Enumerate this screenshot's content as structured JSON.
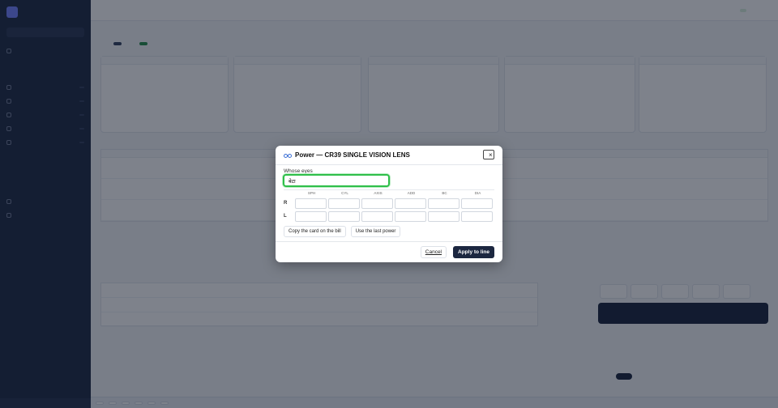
{
  "modal": {
    "title": "Power — CR39 SINGLE VISION LENS",
    "whose_eyes_label": "Whose eyes",
    "whose_eyes_value": "बेटा",
    "columns": [
      "SPH",
      "CYL",
      "AXIS",
      "ADD",
      "BC",
      "DIA"
    ],
    "rows": [
      {
        "eye": "R",
        "values": [
          "",
          "",
          "",
          "",
          "",
          ""
        ]
      },
      {
        "eye": "L",
        "values": [
          "",
          "",
          "",
          "",
          "",
          ""
        ]
      }
    ],
    "copy_card_button": "Copy the card on the bill",
    "use_last_button": "Use the last power",
    "cancel_button": "Cancel",
    "apply_button": "Apply to line",
    "close_symbol": "×"
  },
  "colors": {
    "focus_ring": "#2fbf4a",
    "apply_bg": "#1c2740",
    "overlay": "rgba(20,28,44,0.55)"
  },
  "icons": [
    "glasses-icon",
    "close-icon"
  ]
}
